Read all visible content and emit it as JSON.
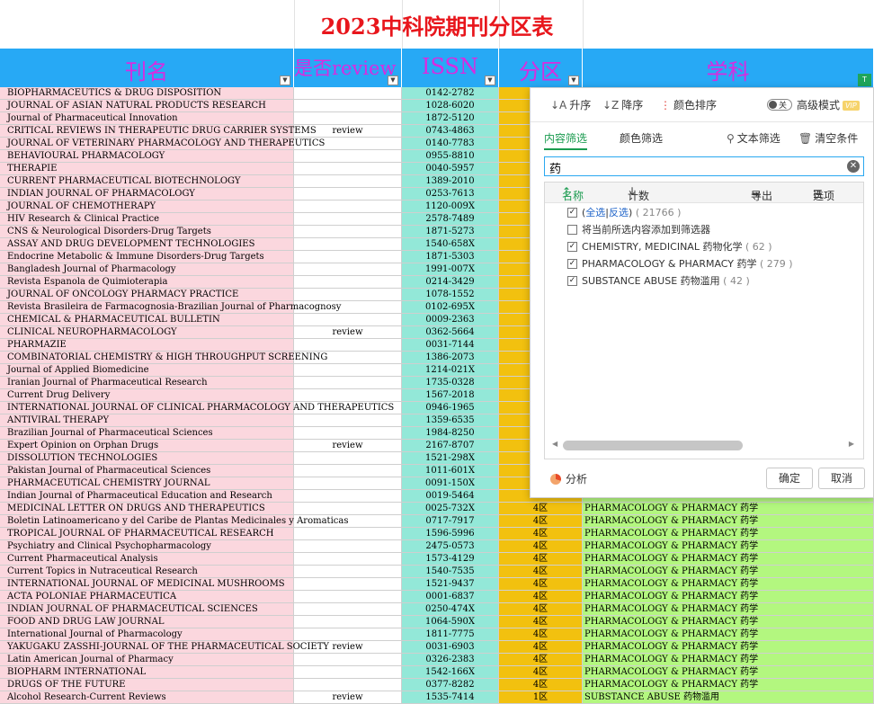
{
  "title": "2023中科院期刊分区表",
  "headers": {
    "name": "刊名",
    "review": "是否review",
    "issn": "ISSN",
    "partition": "分区",
    "subject": "学科"
  },
  "rows": [
    {
      "name": "BIOPHARMACEUTICS & DRUG DISPOSITION",
      "review": "",
      "issn": "0142-2782",
      "partition": "",
      "subject": ""
    },
    {
      "name": "JOURNAL OF ASIAN NATURAL PRODUCTS RESEARCH",
      "review": "",
      "issn": "1028-6020",
      "partition": "",
      "subject": ""
    },
    {
      "name": "Journal of Pharmaceutical Innovation",
      "review": "",
      "issn": "1872-5120",
      "partition": "",
      "subject": ""
    },
    {
      "name": "CRITICAL REVIEWS IN THERAPEUTIC DRUG CARRIER SYSTEMS",
      "review": "review",
      "issn": "0743-4863",
      "partition": "",
      "subject": ""
    },
    {
      "name": "JOURNAL OF VETERINARY PHARMACOLOGY AND THERAPEUTICS",
      "review": "",
      "issn": "0140-7783",
      "partition": "",
      "subject": ""
    },
    {
      "name": "BEHAVIOURAL PHARMACOLOGY",
      "review": "",
      "issn": "0955-8810",
      "partition": "",
      "subject": ""
    },
    {
      "name": "THERAPIE",
      "review": "",
      "issn": "0040-5957",
      "partition": "",
      "subject": ""
    },
    {
      "name": "CURRENT PHARMACEUTICAL BIOTECHNOLOGY",
      "review": "",
      "issn": "1389-2010",
      "partition": "",
      "subject": ""
    },
    {
      "name": "INDIAN JOURNAL OF PHARMACOLOGY",
      "review": "",
      "issn": "0253-7613",
      "partition": "",
      "subject": ""
    },
    {
      "name": "JOURNAL OF CHEMOTHERAPY",
      "review": "",
      "issn": "1120-009X",
      "partition": "",
      "subject": ""
    },
    {
      "name": "HIV Research & Clinical Practice",
      "review": "",
      "issn": "2578-7489",
      "partition": "",
      "subject": ""
    },
    {
      "name": "CNS & Neurological Disorders-Drug Targets",
      "review": "",
      "issn": "1871-5273",
      "partition": "",
      "subject": ""
    },
    {
      "name": "ASSAY AND DRUG DEVELOPMENT TECHNOLOGIES",
      "review": "",
      "issn": "1540-658X",
      "partition": "",
      "subject": ""
    },
    {
      "name": "Endocrine Metabolic & Immune Disorders-Drug Targets",
      "review": "",
      "issn": "1871-5303",
      "partition": "",
      "subject": ""
    },
    {
      "name": "Bangladesh Journal of Pharmacology",
      "review": "",
      "issn": "1991-007X",
      "partition": "",
      "subject": ""
    },
    {
      "name": "Revista Espanola de Quimioterapia",
      "review": "",
      "issn": "0214-3429",
      "partition": "",
      "subject": ""
    },
    {
      "name": "JOURNAL OF ONCOLOGY PHARMACY PRACTICE",
      "review": "",
      "issn": "1078-1552",
      "partition": "",
      "subject": ""
    },
    {
      "name": "Revista Brasileira de Farmacognosia-Brazilian Journal of Pharmacognosy",
      "review": "",
      "issn": "0102-695X",
      "partition": "",
      "subject": ""
    },
    {
      "name": "CHEMICAL & PHARMACEUTICAL BULLETIN",
      "review": "",
      "issn": "0009-2363",
      "partition": "",
      "subject": ""
    },
    {
      "name": "CLINICAL NEUROPHARMACOLOGY",
      "review": "review",
      "issn": "0362-5664",
      "partition": "",
      "subject": ""
    },
    {
      "name": "PHARMAZIE",
      "review": "",
      "issn": "0031-7144",
      "partition": "",
      "subject": ""
    },
    {
      "name": "COMBINATORIAL CHEMISTRY & HIGH THROUGHPUT SCREENING",
      "review": "",
      "issn": "1386-2073",
      "partition": "",
      "subject": ""
    },
    {
      "name": "Journal of Applied Biomedicine",
      "review": "",
      "issn": "1214-021X",
      "partition": "",
      "subject": ""
    },
    {
      "name": "Iranian Journal of Pharmaceutical Research",
      "review": "",
      "issn": "1735-0328",
      "partition": "",
      "subject": ""
    },
    {
      "name": "Current Drug Delivery",
      "review": "",
      "issn": "1567-2018",
      "partition": "",
      "subject": ""
    },
    {
      "name": "INTERNATIONAL JOURNAL OF CLINICAL PHARMACOLOGY AND THERAPEUTICS",
      "review": "",
      "issn": "0946-1965",
      "partition": "",
      "subject": ""
    },
    {
      "name": "ANTIVIRAL THERAPY",
      "review": "",
      "issn": "1359-6535",
      "partition": "",
      "subject": ""
    },
    {
      "name": "Brazilian Journal of Pharmaceutical Sciences",
      "review": "",
      "issn": "1984-8250",
      "partition": "",
      "subject": ""
    },
    {
      "name": "Expert Opinion on Orphan Drugs",
      "review": "review",
      "issn": "2167-8707",
      "partition": "",
      "subject": ""
    },
    {
      "name": "DISSOLUTION TECHNOLOGIES",
      "review": "",
      "issn": "1521-298X",
      "partition": "",
      "subject": ""
    },
    {
      "name": "Pakistan Journal of Pharmaceutical Sciences",
      "review": "",
      "issn": "1011-601X",
      "partition": "",
      "subject": ""
    },
    {
      "name": "PHARMACEUTICAL CHEMISTRY JOURNAL",
      "review": "",
      "issn": "0091-150X",
      "partition": "",
      "subject": ""
    },
    {
      "name": "Indian Journal of Pharmaceutical Education and Research",
      "review": "",
      "issn": "0019-5464",
      "partition": "",
      "subject": ""
    },
    {
      "name": "MEDICINAL LETTER ON DRUGS AND THERAPEUTICS",
      "review": "",
      "issn": "0025-732X",
      "partition": "4区",
      "subject": "PHARMACOLOGY & PHARMACY 药学"
    },
    {
      "name": "Boletin Latinoamericano y del Caribe de Plantas Medicinales y Aromaticas",
      "review": "",
      "issn": "0717-7917",
      "partition": "4区",
      "subject": "PHARMACOLOGY & PHARMACY 药学"
    },
    {
      "name": "TROPICAL JOURNAL OF PHARMACEUTICAL RESEARCH",
      "review": "",
      "issn": "1596-5996",
      "partition": "4区",
      "subject": "PHARMACOLOGY & PHARMACY 药学"
    },
    {
      "name": "Psychiatry and Clinical Psychopharmacology",
      "review": "",
      "issn": "2475-0573",
      "partition": "4区",
      "subject": "PHARMACOLOGY & PHARMACY 药学"
    },
    {
      "name": "Current Pharmaceutical Analysis",
      "review": "",
      "issn": "1573-4129",
      "partition": "4区",
      "subject": "PHARMACOLOGY & PHARMACY 药学"
    },
    {
      "name": "Current Topics in Nutraceutical Research",
      "review": "",
      "issn": "1540-7535",
      "partition": "4区",
      "subject": "PHARMACOLOGY & PHARMACY 药学"
    },
    {
      "name": "INTERNATIONAL JOURNAL OF MEDICINAL MUSHROOMS",
      "review": "",
      "issn": "1521-9437",
      "partition": "4区",
      "subject": "PHARMACOLOGY & PHARMACY 药学"
    },
    {
      "name": "ACTA POLONIAE PHARMACEUTICA",
      "review": "",
      "issn": "0001-6837",
      "partition": "4区",
      "subject": "PHARMACOLOGY & PHARMACY 药学"
    },
    {
      "name": "INDIAN JOURNAL OF PHARMACEUTICAL SCIENCES",
      "review": "",
      "issn": "0250-474X",
      "partition": "4区",
      "subject": "PHARMACOLOGY & PHARMACY 药学"
    },
    {
      "name": "FOOD AND DRUG LAW JOURNAL",
      "review": "",
      "issn": "1064-590X",
      "partition": "4区",
      "subject": "PHARMACOLOGY & PHARMACY 药学"
    },
    {
      "name": "International Journal of Pharmacology",
      "review": "",
      "issn": "1811-7775",
      "partition": "4区",
      "subject": "PHARMACOLOGY & PHARMACY 药学"
    },
    {
      "name": "YAKUGAKU ZASSHI-JOURNAL OF THE PHARMACEUTICAL SOCIETY",
      "review": "review",
      "issn": "0031-6903",
      "partition": "4区",
      "subject": "PHARMACOLOGY & PHARMACY 药学"
    },
    {
      "name": "Latin American Journal of Pharmacy",
      "review": "",
      "issn": "0326-2383",
      "partition": "4区",
      "subject": "PHARMACOLOGY & PHARMACY 药学"
    },
    {
      "name": "BIOPHARM INTERNATIONAL",
      "review": "",
      "issn": "1542-166X",
      "partition": "4区",
      "subject": "PHARMACOLOGY & PHARMACY 药学"
    },
    {
      "name": "DRUGS OF THE FUTURE",
      "review": "",
      "issn": "0377-8282",
      "partition": "4区",
      "subject": "PHARMACOLOGY & PHARMACY 药学"
    },
    {
      "name": "Alcohol Research-Current Reviews",
      "review": "review",
      "issn": "1535-7414",
      "partition": "1区",
      "subject": "SUBSTANCE ABUSE 药物滥用"
    }
  ],
  "filter_panel": {
    "sort_asc": "升序",
    "sort_desc": "降序",
    "sort_color": "颜色排序",
    "toggle_state": "关",
    "advanced_mode": "高级模式",
    "vip": "VIP",
    "tab_content": "内容筛选",
    "tab_color": "颜色筛选",
    "text_filter": "文本筛选",
    "clear": "清空条件",
    "search_value": "药",
    "col_name": "名称",
    "col_count": "计数",
    "export": "导出",
    "options": "选项",
    "select_all": "全选",
    "invert": "反选",
    "select_all_count": "( 21766 )",
    "add_to_filter": "将当前所选内容添加到筛选器",
    "items": [
      {
        "label": "CHEMISTRY, MEDICINAL 药物化学",
        "count": "( 62 )",
        "checked": true
      },
      {
        "label": "PHARMACOLOGY & PHARMACY 药学",
        "count": "( 279 )",
        "checked": true
      },
      {
        "label": "SUBSTANCE ABUSE 药物滥用",
        "count": "( 42 )",
        "checked": true
      }
    ],
    "analyze": "分析",
    "ok": "确定",
    "cancel": "取消"
  },
  "colors": {
    "title": "#e8161c",
    "header_bg": "#27a9f5",
    "header_text": "#d92be0",
    "name_col": "#fbd7de",
    "issn_col": "#93e8d8",
    "partition_col": "#f2c10f",
    "subject_col": "#b3f77f",
    "accent": "#1a9b4f"
  }
}
